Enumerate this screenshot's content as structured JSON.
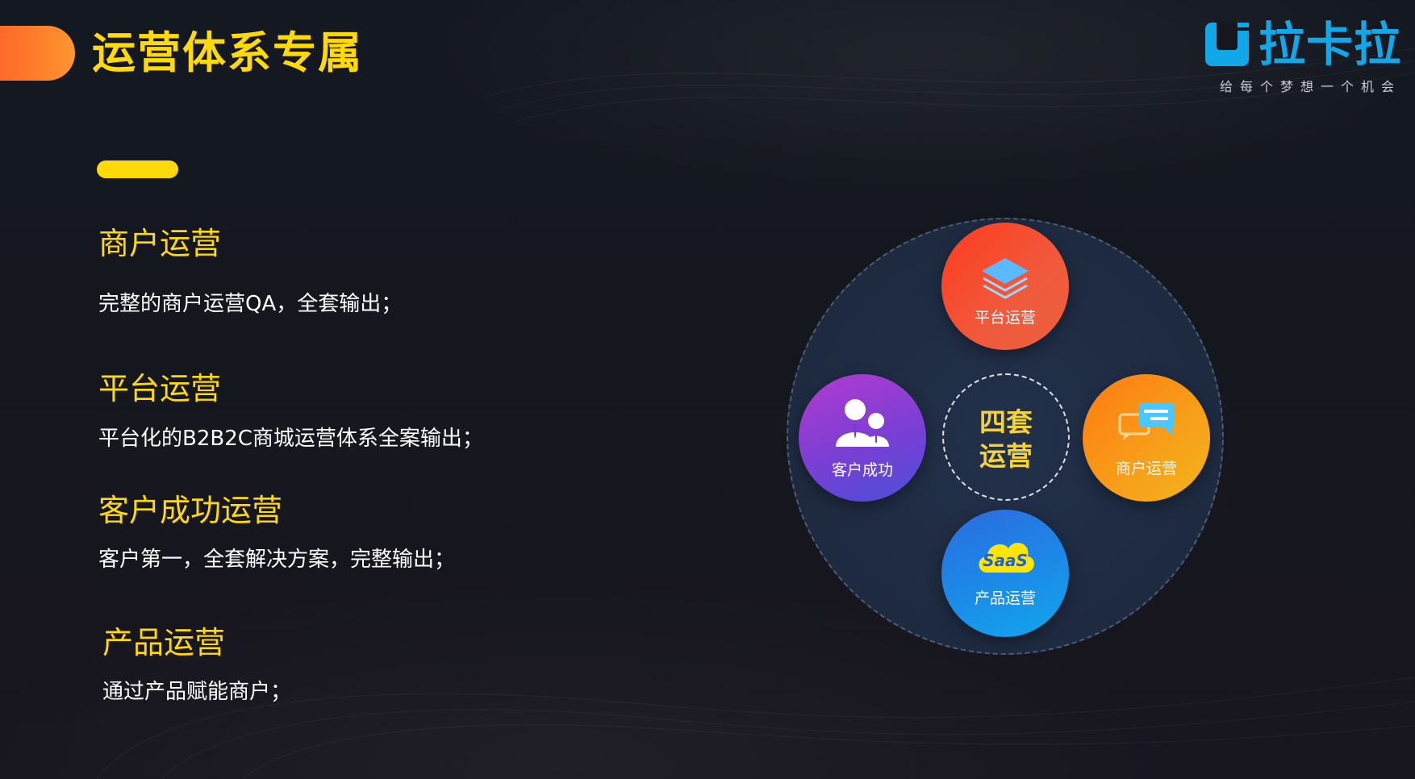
{
  "header": {
    "title": "运营体系专属"
  },
  "logo": {
    "name": "拉卡拉",
    "slogan": "给每个梦想一个机会",
    "brand_color": "#12a7e8"
  },
  "colors": {
    "accent_yellow": "#ffd90a",
    "title_pill_orange": "#ff7a2a"
  },
  "sections": [
    {
      "heading": "商户运营",
      "text": "完整的商户运营QA，全套输出；"
    },
    {
      "heading": "平台运营",
      "text": "平台化的B2B2C商城运营体系全案输出；"
    },
    {
      "heading": "客户成功运营",
      "text": "客户第一，全套解决方案，完整输出；"
    },
    {
      "heading": "产品运营",
      "text": "通过产品赋能商户；"
    }
  ],
  "diagram": {
    "center_line1": "四套",
    "center_line2": "运营",
    "nodes": {
      "top": {
        "label": "平台运营",
        "icon": "layers-icon"
      },
      "left": {
        "label": "客户成功",
        "icon": "users-icon"
      },
      "right": {
        "label": "商户运营",
        "icon": "chat-bubbles-icon"
      },
      "bottom": {
        "label": "产品运营",
        "icon": "saas-cloud-icon",
        "icon_text": "SaaS"
      }
    }
  }
}
